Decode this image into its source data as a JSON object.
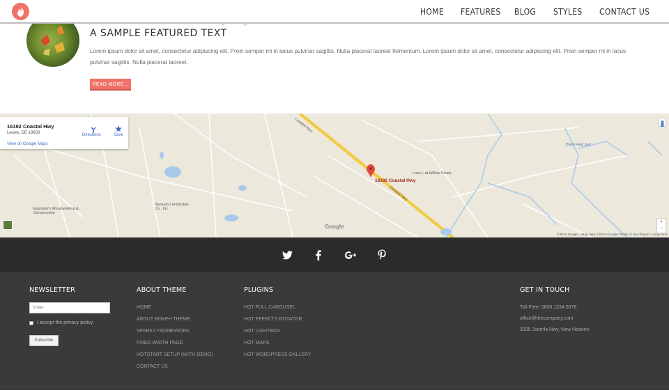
{
  "header": {
    "nav": [
      "HOME",
      "FEATURES",
      "BLOG",
      "STYLES",
      "CONTACT US"
    ],
    "logo_icon": "flame-icon",
    "accent": "#f07167"
  },
  "featured": {
    "script_text": "What's hot in our company",
    "title": "A SAMPLE FEATURED TEXT",
    "body": "Lorem ipsum dolor sit amet, consectetur adipiscing elit. Proin semper mi in lacus pulvinar sagittis. Nulla placerat laoreet fermentum. Lorem ipsum dolor sit amet, consectetur adipiscing elit. Proin semper mi in lacus pulvinar sagittis. Nulla placerat laoreet.",
    "button": "READ MORE..."
  },
  "map": {
    "card": {
      "address": "16192 Coastal Hwy",
      "city": "Lewes, DE 19958",
      "view_link": "View on Google Maps",
      "directions": "Directions",
      "save": "Save"
    },
    "pin_label": "16192 Coastal Hwy",
    "google": "Google",
    "footer": "©2014 Google - Map data ©2014 Google   Terms of Use   Report a map error",
    "labels": {
      "coastal_hwy_1": "Coastal Hwy",
      "coastal_hwy_2": "Coastal Hwy",
      "lazy_l": "Lazy L at Willow Creek",
      "black_hog": "Black Hog Gut",
      "espositos": "Esposito's Woodworking & Construction",
      "sposato": "Sposato Landscape Co., Inc"
    }
  },
  "social": [
    "twitter-icon",
    "facebook-icon",
    "google-plus-icon",
    "pinterest-icon"
  ],
  "footer": {
    "newsletter": {
      "title": "NEWSLETTER",
      "email_placeholder": "Email",
      "privacy": "I accept the privacy policy.",
      "subscribe": "Subscribe"
    },
    "about": {
      "title": "ABOUT THEME",
      "links": [
        "HOME",
        "ABOUT BOKEH THEME",
        "SPARKY FRAMEWORK",
        "FIXED WIDTH PAGE",
        "HOTSTART SETUP (WITH DEMO)",
        "CONTACT US"
      ]
    },
    "plugins": {
      "title": "PLUGINS",
      "links": [
        "HOT FULL CAROUSEL",
        "HOT EFFECTS ROTATOR",
        "HOT LIGHTBOX",
        "HOT MAPS",
        "HOT WORDPRESS GALLERY"
      ]
    },
    "contact": {
      "title": "GET IN TOUCH",
      "lines": [
        "Toll Free: 0800 1234 5678",
        "office@thecompany.com",
        "3335 Joomla Hwy, New Heaven"
      ]
    }
  }
}
